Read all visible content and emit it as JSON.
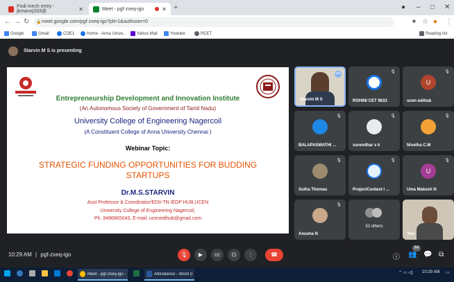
{
  "browser": {
    "tabs": [
      {
        "label": "Fodi mech entry - jkmanoj333@",
        "active": false
      },
      {
        "label": "Meet - pgf-zxeq-igo",
        "active": true
      }
    ],
    "new_tab": "+",
    "url": "meet.google.com/pgf-zxeq-igo?pli=1&authuser=0",
    "bookmarks": [
      "Google",
      "Gmail",
      "COE1",
      "Home - Anna Unive...",
      "Yahoo Mail",
      "Youtube",
      "RCET"
    ],
    "reading_list": "Reading list"
  },
  "presenting": {
    "text": "Starvin M S is presenting"
  },
  "slide": {
    "institute": "Entrepreneurship Development and Innovation Institute",
    "institute_sub": "(An Autonomous Society of Government of Tamil Nadu)",
    "college": "University College of Engineering Nagercoil",
    "college_sub": "(A Constituent College of Anna University Chennai )",
    "topic_label": "Webinar Topic:",
    "topic_line1": "STRATEGIC FUNDING OPPORTUNITIES FOR BUDDING",
    "topic_line2": "STARTUPS",
    "speaker": "Dr.M.S.STARVIN",
    "designation": "Asst Professor & Coordinator/EDII-TN IEDP HUB,UCEN",
    "speaker_college": "University College of Engineering Nagercoil,",
    "contact": "Ph. 9486865043, E-mail: ucenedihub@gmail.com"
  },
  "participants": [
    {
      "name": "Starvin M S",
      "type": "video"
    },
    {
      "name": "ROHINI CET 9633",
      "type": "avatar"
    },
    {
      "name": "ucen edihub",
      "type": "letter",
      "letter": "U",
      "color": "#b0442c"
    },
    {
      "name": "BALAPASWATHI ...",
      "type": "avatar"
    },
    {
      "name": "surendhar s k",
      "type": "avatar"
    },
    {
      "name": "Nivetha C.M",
      "type": "avatar"
    },
    {
      "name": "Sutha Thomas",
      "type": "avatar"
    },
    {
      "name": "ProjectContest I ...",
      "type": "avatar"
    },
    {
      "name": "Uma Makesh N",
      "type": "letter",
      "letter": "U",
      "color": "#a53d96"
    },
    {
      "name": "Anusha N",
      "type": "avatar"
    },
    {
      "name": "52 others",
      "type": "others"
    },
    {
      "name": "You",
      "type": "video"
    }
  ],
  "controls": {
    "time": "10:29 AM",
    "separator": "|",
    "meeting_code": "pgf-zxeq-igo",
    "people_count": "64"
  },
  "taskbar": {
    "apps": [
      "Meet - pgf-zxeq-igo - ...",
      "Attendance - Word (P..."
    ],
    "time": "10:29 AM"
  }
}
